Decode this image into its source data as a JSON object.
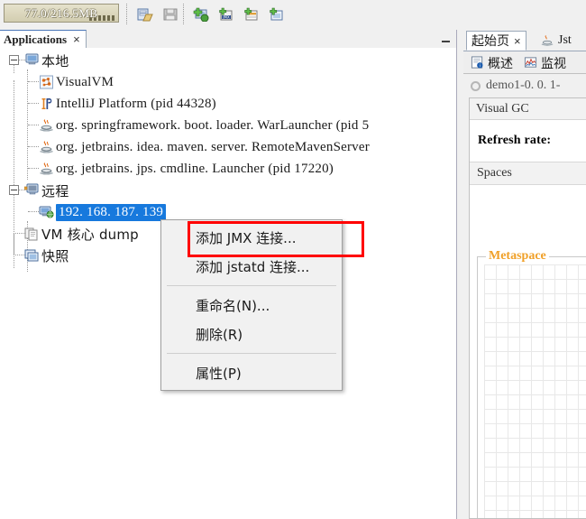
{
  "toolbar": {
    "heap_gauge": {
      "label": "77.0/216.5MB",
      "used_mb": 77.0,
      "total_mb": 216.5
    },
    "buttons": [
      {
        "name": "open-file-button",
        "title": "打开文件"
      },
      {
        "name": "save-snapshot-button",
        "title": "保存"
      },
      {
        "name": "add-remote-host-button",
        "title": "Add Remote Host"
      },
      {
        "name": "add-jmx-connection-button",
        "title": "Add JMX Connection"
      },
      {
        "name": "add-jstatd-connection-button",
        "title": "Add jstatd Connection"
      },
      {
        "name": "add-vm-coredump-button",
        "title": "Add VM Coredump"
      }
    ]
  },
  "left_panel": {
    "tab_title": "Applications",
    "close_glyph": "×",
    "minimize_title": "最小化",
    "tree": [
      {
        "label": "本地",
        "level": 0,
        "icon": "computer-icon",
        "expander": "collapse",
        "cjk": true
      },
      {
        "label": "VisualVM",
        "level": 1,
        "icon": "visualvm-icon",
        "cjk": false
      },
      {
        "label": "IntelliJ Platform (pid 44328)",
        "level": 1,
        "icon": "intellij-icon",
        "cjk": false
      },
      {
        "label": "org. springframework. boot. loader. WarLauncher  (pid 5",
        "level": 1,
        "icon": "java-icon",
        "cjk": false
      },
      {
        "label": "org. jetbrains. idea. maven. server. RemoteMavenServer",
        "level": 1,
        "icon": "java-icon",
        "cjk": false
      },
      {
        "label": "org. jetbrains. jps. cmdline. Launcher  (pid 17220)",
        "level": 1,
        "icon": "java-icon",
        "cjk": false
      },
      {
        "label": "远程",
        "level": 0,
        "icon": "remote-host-icon",
        "expander": "collapse",
        "cjk": true
      },
      {
        "label": "192. 168. 187. 139",
        "level": 1,
        "icon": "remote-node-icon",
        "selected": true,
        "cjk": false
      },
      {
        "label": "VM 核心 dump",
        "level": 0,
        "icon": "coredump-icon",
        "cjk": true
      },
      {
        "label": "快照",
        "level": 0,
        "icon": "snapshot-icon",
        "cjk": true
      }
    ]
  },
  "context_menu": {
    "highlight_color": "#ff0000",
    "items": [
      {
        "label": "添加 JMX 连接...",
        "highlighted": true
      },
      {
        "label": "添加 jstatd 连接...",
        "highlighted": false
      },
      {
        "separator": true
      },
      {
        "label": "重命名(N)...",
        "highlighted": false
      },
      {
        "label": "删除(R)",
        "highlighted": false
      },
      {
        "separator": true
      },
      {
        "label": "属性(P)",
        "highlighted": false
      }
    ]
  },
  "right_panel": {
    "tabs": [
      {
        "label": "起始页",
        "icon": "start-page-icon",
        "closable": true,
        "close_glyph": "×",
        "active": true
      },
      {
        "label": "Jst",
        "icon": "java-icon",
        "closable": false,
        "active": false
      }
    ],
    "subtabs": [
      {
        "label": "概述",
        "icon": "overview-icon"
      },
      {
        "label": "监视",
        "icon": "monitor-icon"
      }
    ],
    "application_line": "demo1-0. 0. 1-",
    "card_title": "Visual GC",
    "refresh_label": "Refresh rate:",
    "spaces_label": "Spaces",
    "group_title": "Metaspace",
    "group_title_color": "#f0a028"
  }
}
